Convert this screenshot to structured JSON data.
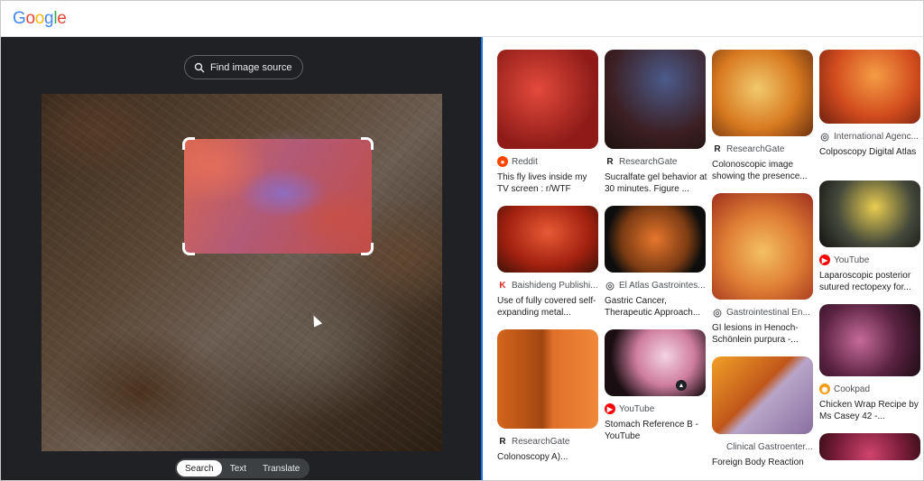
{
  "header": {
    "logo_letters": [
      {
        "ch": "G",
        "color": "#4285f4"
      },
      {
        "ch": "o",
        "color": "#ea4335"
      },
      {
        "ch": "o",
        "color": "#fbbc05"
      },
      {
        "ch": "g",
        "color": "#4285f4"
      },
      {
        "ch": "l",
        "color": "#34a853"
      },
      {
        "ch": "e",
        "color": "#ea4335"
      }
    ]
  },
  "lens": {
    "find_source_label": "Find image source",
    "modes": [
      {
        "label": "Search",
        "active": true
      },
      {
        "label": "Text",
        "active": false
      },
      {
        "label": "Translate",
        "active": false
      }
    ]
  },
  "results": {
    "columns": [
      [
        {
          "source": "Reddit",
          "icon": "reddit-icon",
          "icon_color": "#ff4500",
          "title": "This fly lives inside my TV screen : r/WTF",
          "thumb": "g1",
          "h": 110
        },
        {
          "source": "Baishideng Publishi...",
          "icon": "baishideng-icon",
          "icon_color": "#d93025",
          "title": "Use of fully covered self-expanding metal...",
          "thumb": "g5",
          "h": 74
        },
        {
          "source": "ResearchGate",
          "icon": "researchgate-icon",
          "icon_color": "#202124",
          "title": "Colonoscopy A)...",
          "thumb": "g9",
          "h": 110
        }
      ],
      [
        {
          "source": "ResearchGate",
          "icon": "researchgate-icon",
          "icon_color": "#202124",
          "title": "Sucralfate gel behavior at 30 minutes. Figure ...",
          "thumb": "g2",
          "h": 110
        },
        {
          "source": "El Atlas Gastrointes...",
          "icon": "globe-icon",
          "icon_color": "#5f6368",
          "title": "Gastric Cancer, Therapeutic Approach...",
          "thumb": "g6",
          "h": 74
        },
        {
          "source": "YouTube",
          "icon": "youtube-icon",
          "icon_color": "#ff0000",
          "title": "Stomach Reference B - YouTube",
          "thumb": "g10",
          "h": 74
        }
      ],
      [
        {
          "source": "ResearchGate",
          "icon": "researchgate-icon",
          "icon_color": "#202124",
          "title": "Colonoscopic image showing the presence...",
          "thumb": "g3",
          "h": 96
        },
        {
          "source": "Gastrointestinal En...",
          "icon": "globe-icon",
          "icon_color": "#5f6368",
          "title": "GI lesions in Henoch-Schönlein purpura -...",
          "thumb": "g7",
          "h": 118
        },
        {
          "source": "Clinical Gastroenter...",
          "icon": "clinical-gastro-icon",
          "icon_color": "#ffffff",
          "title": "Foreign Body Reaction",
          "thumb": "g11",
          "h": 86
        }
      ],
      [
        {
          "source": "International Agenc...",
          "icon": "globe-icon",
          "icon_color": "#5f6368",
          "title": "Colposcopy Digital Atlas",
          "thumb": "g4",
          "h": 82
        },
        {
          "source": "YouTube",
          "icon": "youtube-icon",
          "icon_color": "#ff0000",
          "title": "Laparoscopic posterior sutured rectopexy for...",
          "thumb": "g8",
          "h": 74
        },
        {
          "source": "Cookpad",
          "icon": "cookpad-icon",
          "icon_color": "#f39c12",
          "title": "Chicken Wrap Recipe by Ms Casey 42 -...",
          "thumb": "g12",
          "h": 80
        },
        {
          "source": "",
          "icon": "",
          "icon_color": "#ffffff",
          "title": "",
          "thumb": "g13",
          "h": 30
        }
      ]
    ]
  }
}
